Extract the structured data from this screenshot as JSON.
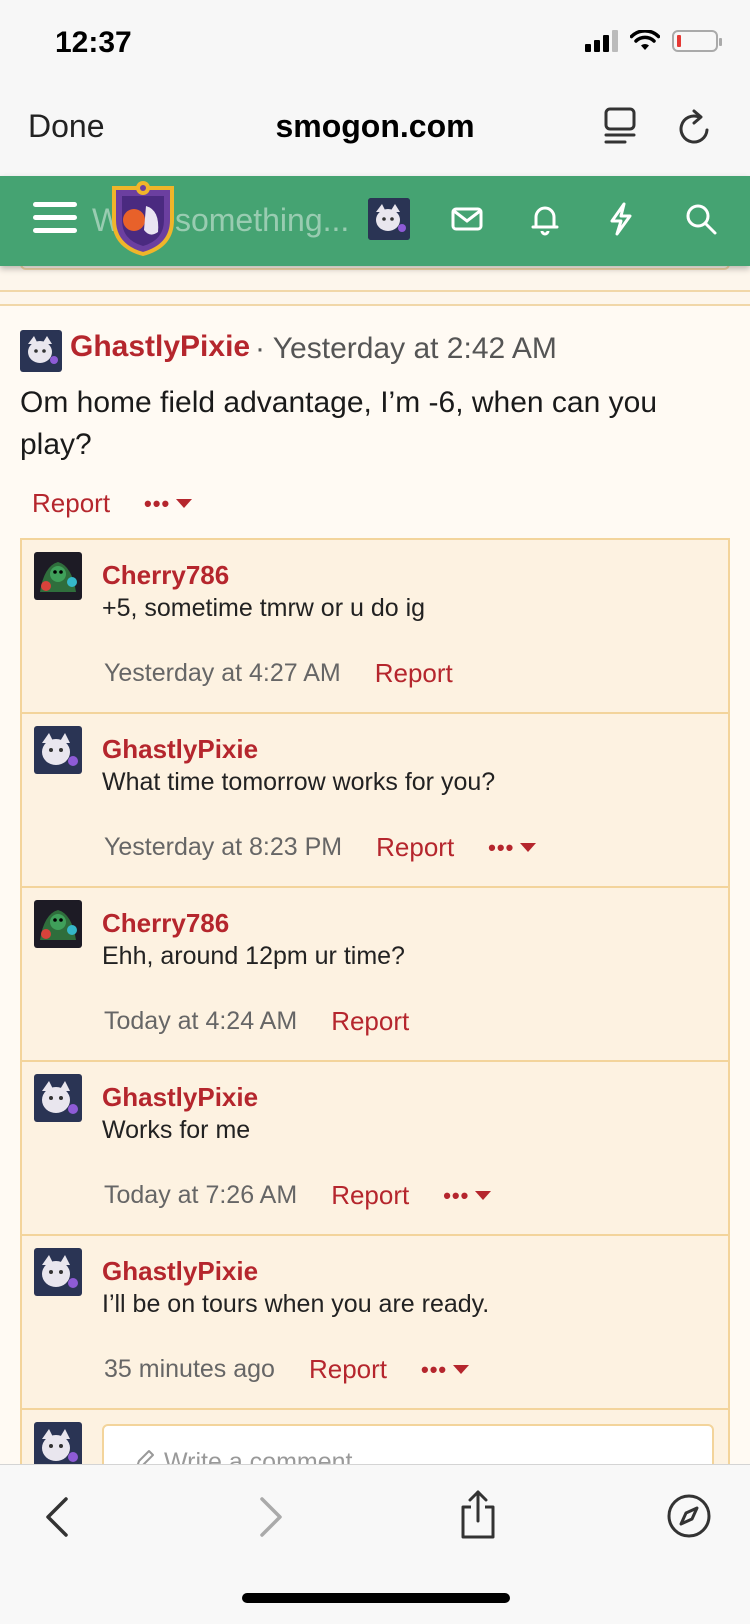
{
  "status_bar": {
    "time": "12:37"
  },
  "browser": {
    "done_label": "Done",
    "domain": "smogon.com"
  },
  "site_header": {
    "search_ghost_text": "Write something..."
  },
  "post": {
    "author": "GhastlyPixie",
    "separator": "·",
    "time": "Yesterday at 2:42 AM",
    "text": "Om home field advantage, I’m -6, when can you play?",
    "report_label": "Report",
    "more_label": "•••"
  },
  "comments": [
    {
      "author": "Cherry786",
      "text": "+5, sometime tmrw or u do ig",
      "time": "Yesterday at 4:27 AM",
      "report_label": "Report",
      "has_more": false,
      "avatar": "cherry"
    },
    {
      "author": "GhastlyPixie",
      "text": "What time tomorrow works for you?",
      "time": "Yesterday at 8:23 PM",
      "report_label": "Report",
      "has_more": true,
      "avatar": "ghastly"
    },
    {
      "author": "Cherry786",
      "text": "Ehh, around 12pm ur time?",
      "time": "Today at 4:24 AM",
      "report_label": "Report",
      "has_more": false,
      "avatar": "cherry"
    },
    {
      "author": "GhastlyPixie",
      "text": "Works for me",
      "time": "Today at 7:26 AM",
      "report_label": "Report",
      "has_more": true,
      "avatar": "ghastly"
    },
    {
      "author": "GhastlyPixie",
      "text": "I’ll be on tours when you are ready.",
      "time": "35 minutes ago",
      "report_label": "Report",
      "has_more": true,
      "avatar": "ghastly"
    }
  ],
  "comment_input": {
    "placeholder": "Write a comment..."
  },
  "colors": {
    "header_green": "#45a372",
    "link_red": "#b5262d",
    "comment_bg": "#fdf2e1",
    "comment_border": "#f3d49b"
  },
  "icons": [
    "reader-icon",
    "reload-icon",
    "hamburger-icon",
    "mail-icon",
    "bell-icon",
    "lightning-icon",
    "search-icon",
    "back-icon",
    "forward-icon",
    "share-icon",
    "compass-icon"
  ]
}
